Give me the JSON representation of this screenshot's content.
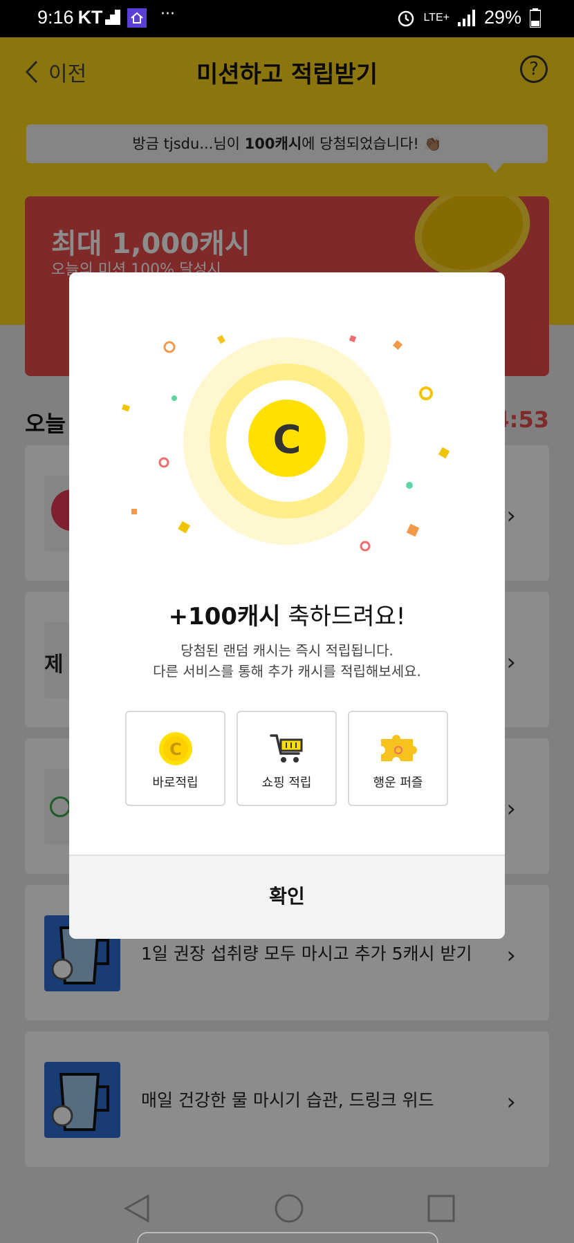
{
  "status_bar": {
    "time": "9:16",
    "carrier": "KT",
    "network": "LTE+",
    "battery": "29%"
  },
  "header": {
    "back_label": "이전",
    "title": "미션하고 적립받기",
    "help_icon": "question-icon"
  },
  "notice": {
    "prefix": "방금 tjsdu...님이 ",
    "highlight": "100캐시",
    "suffix": "에 당첨되었습니다! 👏🏽"
  },
  "banner": {
    "title": "최대 1,000캐시",
    "subtitle": "오늘의 미션 100% 달성시"
  },
  "section": {
    "today_label": "오늘",
    "timer": "4:53"
  },
  "missions": [
    {
      "text": "",
      "thumb_color": "#e63b56"
    },
    {
      "text": "제",
      "thumb_color": "#f2f2f2"
    },
    {
      "text": "",
      "thumb_color": "#f2f2f2"
    },
    {
      "text": "1일 권장 섭취량 모두 마시고 추가 5캐시 받기",
      "thumb_color": "#2f6fcf"
    },
    {
      "text": "매일 건강한 물 마시기 습관, 드링크 위드",
      "thumb_color": "#2f6fcf"
    }
  ],
  "modal": {
    "coin_letter": "C",
    "title_strong": "+100캐시",
    "title_rest": " 축하드려요!",
    "desc_line1": "당첨된 랜덤 캐시는 즉시 적립됩니다.",
    "desc_line2": "다른 서비스를 통해 추가 캐시를 적립해보세요.",
    "options": [
      {
        "label": "바로적립",
        "icon": "coin-icon"
      },
      {
        "label": "쇼핑 적립",
        "icon": "cart-icon"
      },
      {
        "label": "행운 퍼즐",
        "icon": "puzzle-icon"
      }
    ],
    "confirm_label": "확인"
  },
  "colors": {
    "brand_yellow": "#fcd61b",
    "banner_red": "#e84b4b",
    "coin_yellow": "#ffe000"
  }
}
